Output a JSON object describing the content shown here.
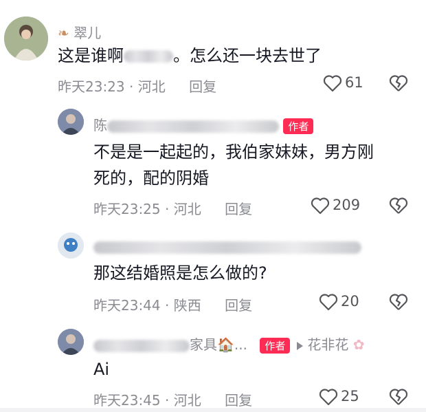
{
  "comments": [
    {
      "name": "翠儿",
      "content": "这是谁啊",
      "content_suffix": "。怎么还一块去世了",
      "time": "昨天23:23",
      "location": "河北",
      "reply_label": "回复",
      "likes": "61",
      "dot": "·"
    },
    {
      "name_visible": "陈",
      "author_badge": "作者",
      "content_line1": "不是是一起起的，我伯家妹妹，男方刚",
      "content_line2": "死的，配的阴婚",
      "time": "昨天23:25",
      "location": "河北",
      "reply_label": "回复",
      "likes": "209",
      "dot": "·"
    },
    {
      "content": "那这结婚照是怎么做的?",
      "time": "昨天23:44",
      "location": "陕西",
      "reply_label": "回复",
      "likes": "20",
      "dot": "·"
    },
    {
      "name_visible": "家具🏠...",
      "author_badge": "作者",
      "reply_to": "花非花",
      "content": "Ai",
      "time": "昨天23:45",
      "location": "河北",
      "reply_label": "回复",
      "likes": "25",
      "dot": "·"
    }
  ],
  "colors": {
    "accent": "#fe2c55",
    "meta": "#8a8b91",
    "text": "#161823"
  },
  "icons": {
    "like": "heart-outline-icon",
    "dislike": "broken-heart-icon",
    "leaf": "leaf-icon"
  }
}
